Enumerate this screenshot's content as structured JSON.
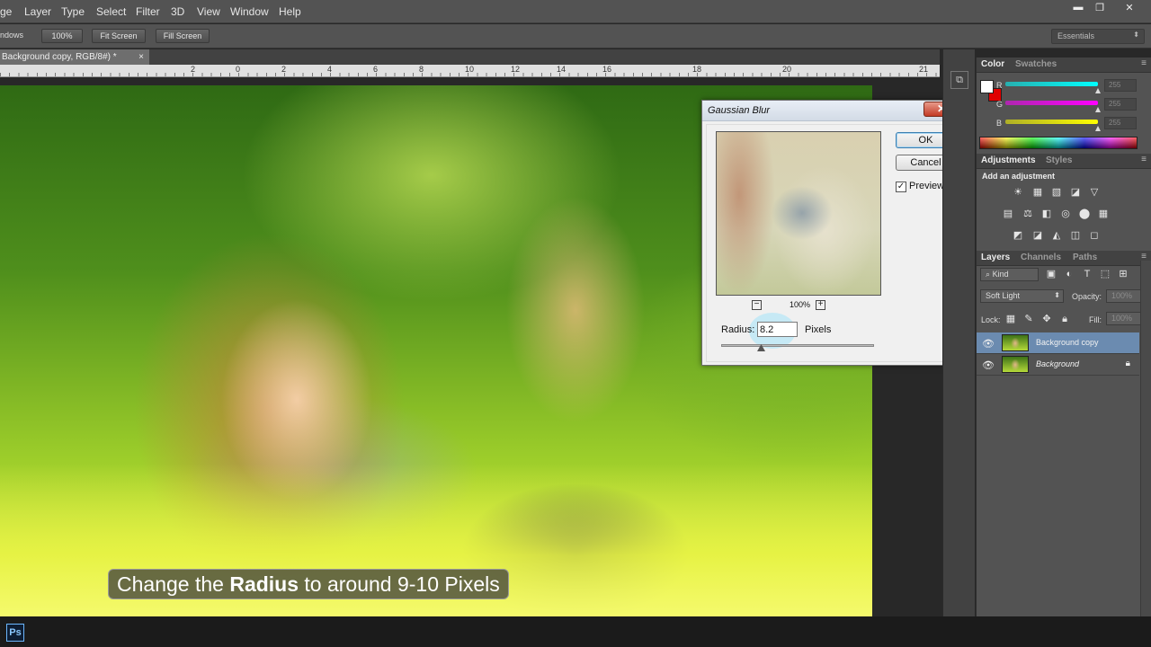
{
  "menu": {
    "items": [
      "ge",
      "Layer",
      "Type",
      "Select",
      "Filter",
      "3D",
      "View",
      "Window",
      "Help"
    ]
  },
  "window_controls": {
    "minimize": "▬",
    "restore": "❐",
    "close": "✕"
  },
  "options_bar": {
    "cut_label": "ndows",
    "zoom_100": "100%",
    "fit_screen": "Fit Screen",
    "fill_screen": "Fill Screen",
    "workspace": "Essentials"
  },
  "document": {
    "tab_title": "Background copy, RGB/8#) *",
    "tab_close": "×",
    "ruler_numbers": [
      "2",
      "0",
      "2",
      "4",
      "6",
      "8",
      "10",
      "12",
      "14",
      "16",
      "18",
      "20",
      "21"
    ]
  },
  "subtitle": {
    "prefix": "Change the ",
    "bold": "Radius",
    "suffix": " to around 9-10 Pixels"
  },
  "dialog": {
    "title": "Gaussian Blur",
    "close": "✕",
    "ok": "OK",
    "cancel": "Cancel",
    "preview_label": "Preview",
    "preview_checked": "✓",
    "zoom_out": "−",
    "zoom_in": "+",
    "zoom_level": "100%",
    "radius_label": "Radius:",
    "radius_value": "8.2",
    "pixels_label": "Pixels"
  },
  "color_panel": {
    "tabs": [
      "Color",
      "Swatches"
    ],
    "channels": [
      {
        "name": "R",
        "value": "255",
        "color": "#00ffff"
      },
      {
        "name": "G",
        "value": "255",
        "color": "#ff00ff"
      },
      {
        "name": "B",
        "value": "255",
        "color": "#ffff00"
      }
    ],
    "foreground": "#ffffff",
    "background": "#e00000"
  },
  "adjustments_panel": {
    "tabs": [
      "Adjustments",
      "Styles"
    ],
    "heading": "Add an adjustment",
    "row1_icons": [
      "☀",
      "▦",
      "▧",
      "◪",
      "▽"
    ],
    "row2_icons": [
      "▤",
      "⚖",
      "◧",
      "◎",
      "⬤",
      "▦"
    ],
    "row3_icons": [
      "◩",
      "◪",
      "◭",
      "◫",
      "◻"
    ]
  },
  "layers_panel": {
    "tabs": [
      "Layers",
      "Channels",
      "Paths"
    ],
    "kind": "Kind",
    "blend_mode": "Soft Light",
    "opacity_label": "Opacity:",
    "opacity_value": "100%",
    "lock_label": "Lock:",
    "fill_label": "Fill:",
    "fill_value": "100%",
    "layers": [
      {
        "name": "Background copy",
        "selected": true,
        "locked": false
      },
      {
        "name": "Background",
        "selected": false,
        "locked": true
      }
    ]
  },
  "taskbar": {
    "app_icon": "Ps"
  }
}
